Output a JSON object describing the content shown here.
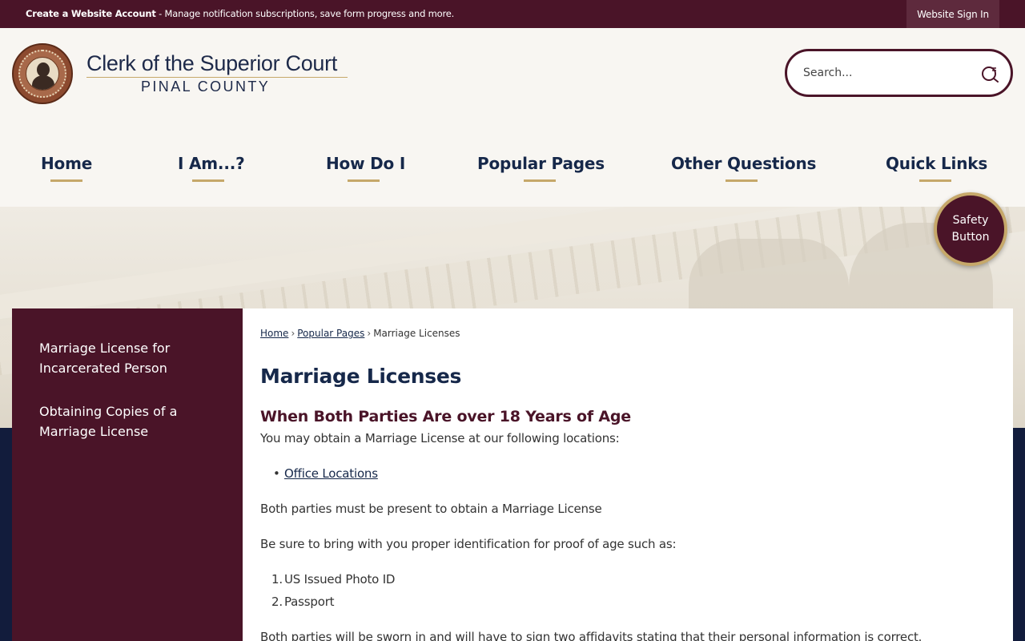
{
  "topbar": {
    "account_bold": "Create a Website Account",
    "account_text": " - Manage notification subscriptions, save form progress and more.",
    "signin_label": "Website Sign In"
  },
  "header": {
    "title": "Clerk of the Superior Court",
    "subtitle": "PINAL COUNTY",
    "search_placeholder": "Search..."
  },
  "nav": {
    "items": [
      {
        "label": "Home"
      },
      {
        "label": "I Am...?"
      },
      {
        "label": "How Do I"
      },
      {
        "label": "Popular Pages"
      },
      {
        "label": "Other Questions"
      },
      {
        "label": "Quick Links"
      }
    ]
  },
  "safety": {
    "line1": "Safety",
    "line2": "Button"
  },
  "sidebar": {
    "items": [
      {
        "line1": "Marriage License for",
        "line2": "Incarcerated Person"
      },
      {
        "line1": "Obtaining Copies of a",
        "line2": "Marriage License"
      }
    ]
  },
  "breadcrumb": {
    "home": "Home",
    "sep": "›",
    "popular": "Popular Pages",
    "current": "Marriage Licenses"
  },
  "content": {
    "title": "Marriage Licenses",
    "section_heading": "When Both Parties Are over 18 Years of Age",
    "intro": "You may obtain a Marriage License at our following locations:",
    "locations_link": "Office Locations",
    "presence": "Both parties must be present to obtain a Marriage License",
    "id_intro": "Be sure to bring with you proper identification for proof of age such as:",
    "id_items": [
      "US Issued Photo ID",
      "Passport"
    ],
    "sworn": "Both parties will be sworn in and will have to sign two affidavits stating that their personal information is correct."
  },
  "colors": {
    "maroon": "#4a1428",
    "navy": "#16284a",
    "gold": "#c6a86a"
  }
}
